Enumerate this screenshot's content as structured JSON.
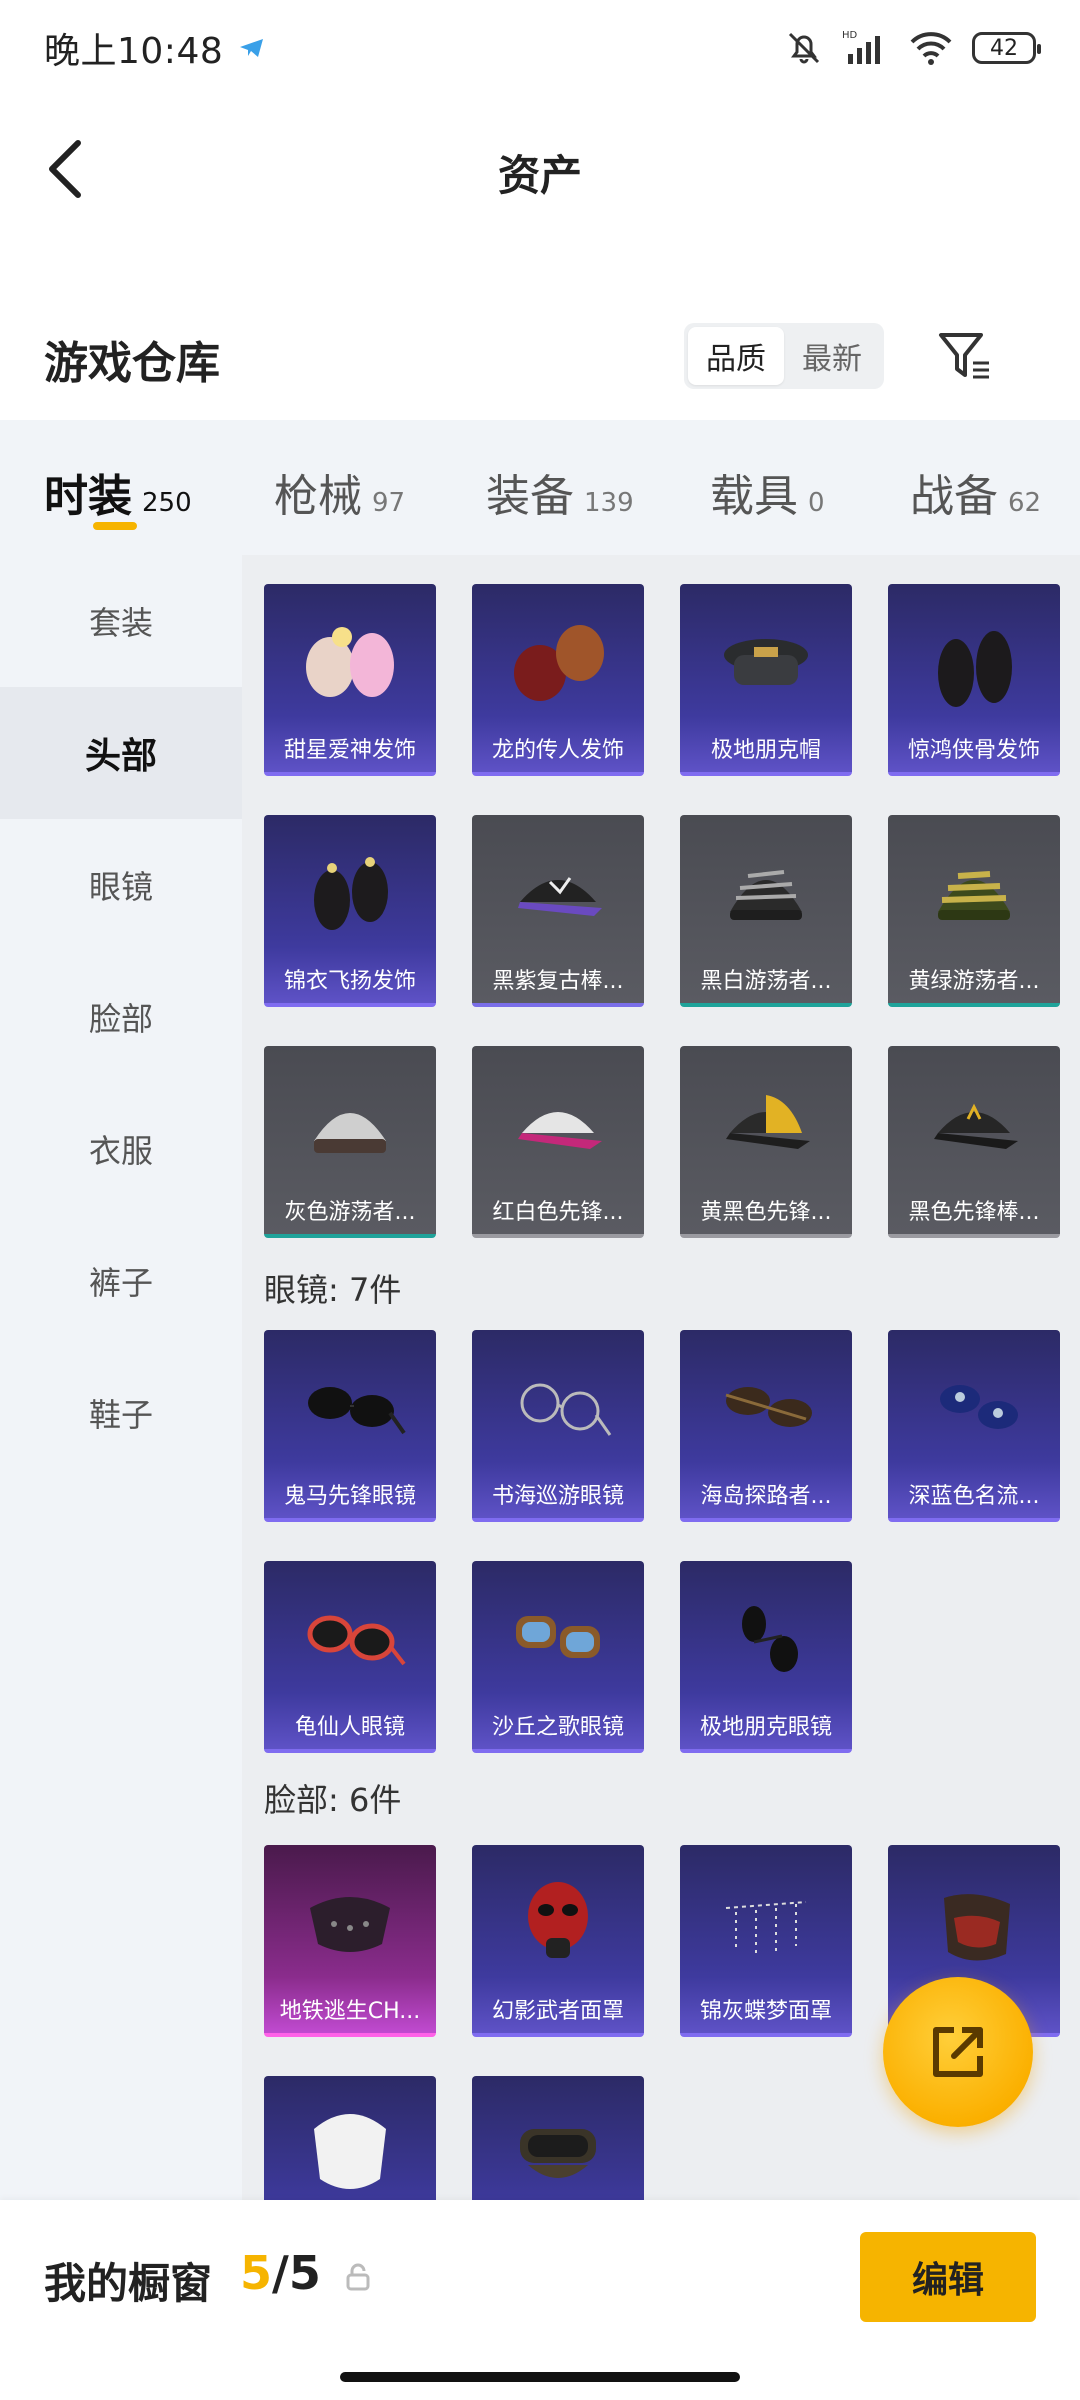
{
  "status_bar": {
    "time": "晚上10:48",
    "battery": "42"
  },
  "header": {
    "title": "资产"
  },
  "warehouse": {
    "title": "游戏仓库",
    "sort_options": [
      "品质",
      "最新"
    ]
  },
  "tabs": [
    {
      "label": "时装",
      "count": "250"
    },
    {
      "label": "枪械",
      "count": "97"
    },
    {
      "label": "装备",
      "count": "139"
    },
    {
      "label": "载具",
      "count": "0"
    },
    {
      "label": "战备",
      "count": "62"
    }
  ],
  "sidebar": {
    "items": [
      {
        "label": "套装"
      },
      {
        "label": "头部"
      },
      {
        "label": "眼镜"
      },
      {
        "label": "脸部"
      },
      {
        "label": "衣服"
      },
      {
        "label": "裤子"
      },
      {
        "label": "鞋子"
      }
    ]
  },
  "sections": [
    {
      "label": "",
      "items": [
        {
          "name": "甜星爱神发饰",
          "rarity": "purple"
        },
        {
          "name": "龙的传人发饰",
          "rarity": "purple"
        },
        {
          "name": "极地朋克帽",
          "rarity": "purple"
        },
        {
          "name": "惊鸿侠骨发饰",
          "rarity": "purple"
        },
        {
          "name": "锦衣飞扬发饰",
          "rarity": "purple"
        },
        {
          "name": "黑紫复古棒...",
          "rarity": "gray-violet"
        },
        {
          "name": "黑白游荡者...",
          "rarity": "gray-teal"
        },
        {
          "name": "黄绿游荡者...",
          "rarity": "gray-teal"
        },
        {
          "name": "灰色游荡者...",
          "rarity": "gray-teal"
        },
        {
          "name": "红白色先锋...",
          "rarity": "gray"
        },
        {
          "name": "黄黑色先锋...",
          "rarity": "gray"
        },
        {
          "name": "黑色先锋棒...",
          "rarity": "gray"
        }
      ]
    },
    {
      "label": "眼镜: 7件",
      "items": [
        {
          "name": "鬼马先锋眼镜",
          "rarity": "purple"
        },
        {
          "name": "书海巡游眼镜",
          "rarity": "purple"
        },
        {
          "name": "海岛探路者...",
          "rarity": "purple"
        },
        {
          "name": "深蓝色名流...",
          "rarity": "purple"
        },
        {
          "name": "龟仙人眼镜",
          "rarity": "purple"
        },
        {
          "name": "沙丘之歌眼镜",
          "rarity": "purple"
        },
        {
          "name": "极地朋克眼镜",
          "rarity": "purple"
        }
      ]
    },
    {
      "label": "脸部: 6件",
      "items": [
        {
          "name": "地铁逃生CH...",
          "rarity": "pink"
        },
        {
          "name": "幻影武者面罩",
          "rarity": "purple"
        },
        {
          "name": "锦灰蝶梦面罩",
          "rarity": "purple"
        },
        {
          "name": "",
          "rarity": "purple"
        },
        {
          "name": "",
          "rarity": "purple"
        },
        {
          "name": "",
          "rarity": "purple"
        }
      ]
    }
  ],
  "showcase": {
    "title": "我的橱窗",
    "current": "5",
    "separator": "/",
    "total": "5",
    "edit_label": "编辑"
  }
}
